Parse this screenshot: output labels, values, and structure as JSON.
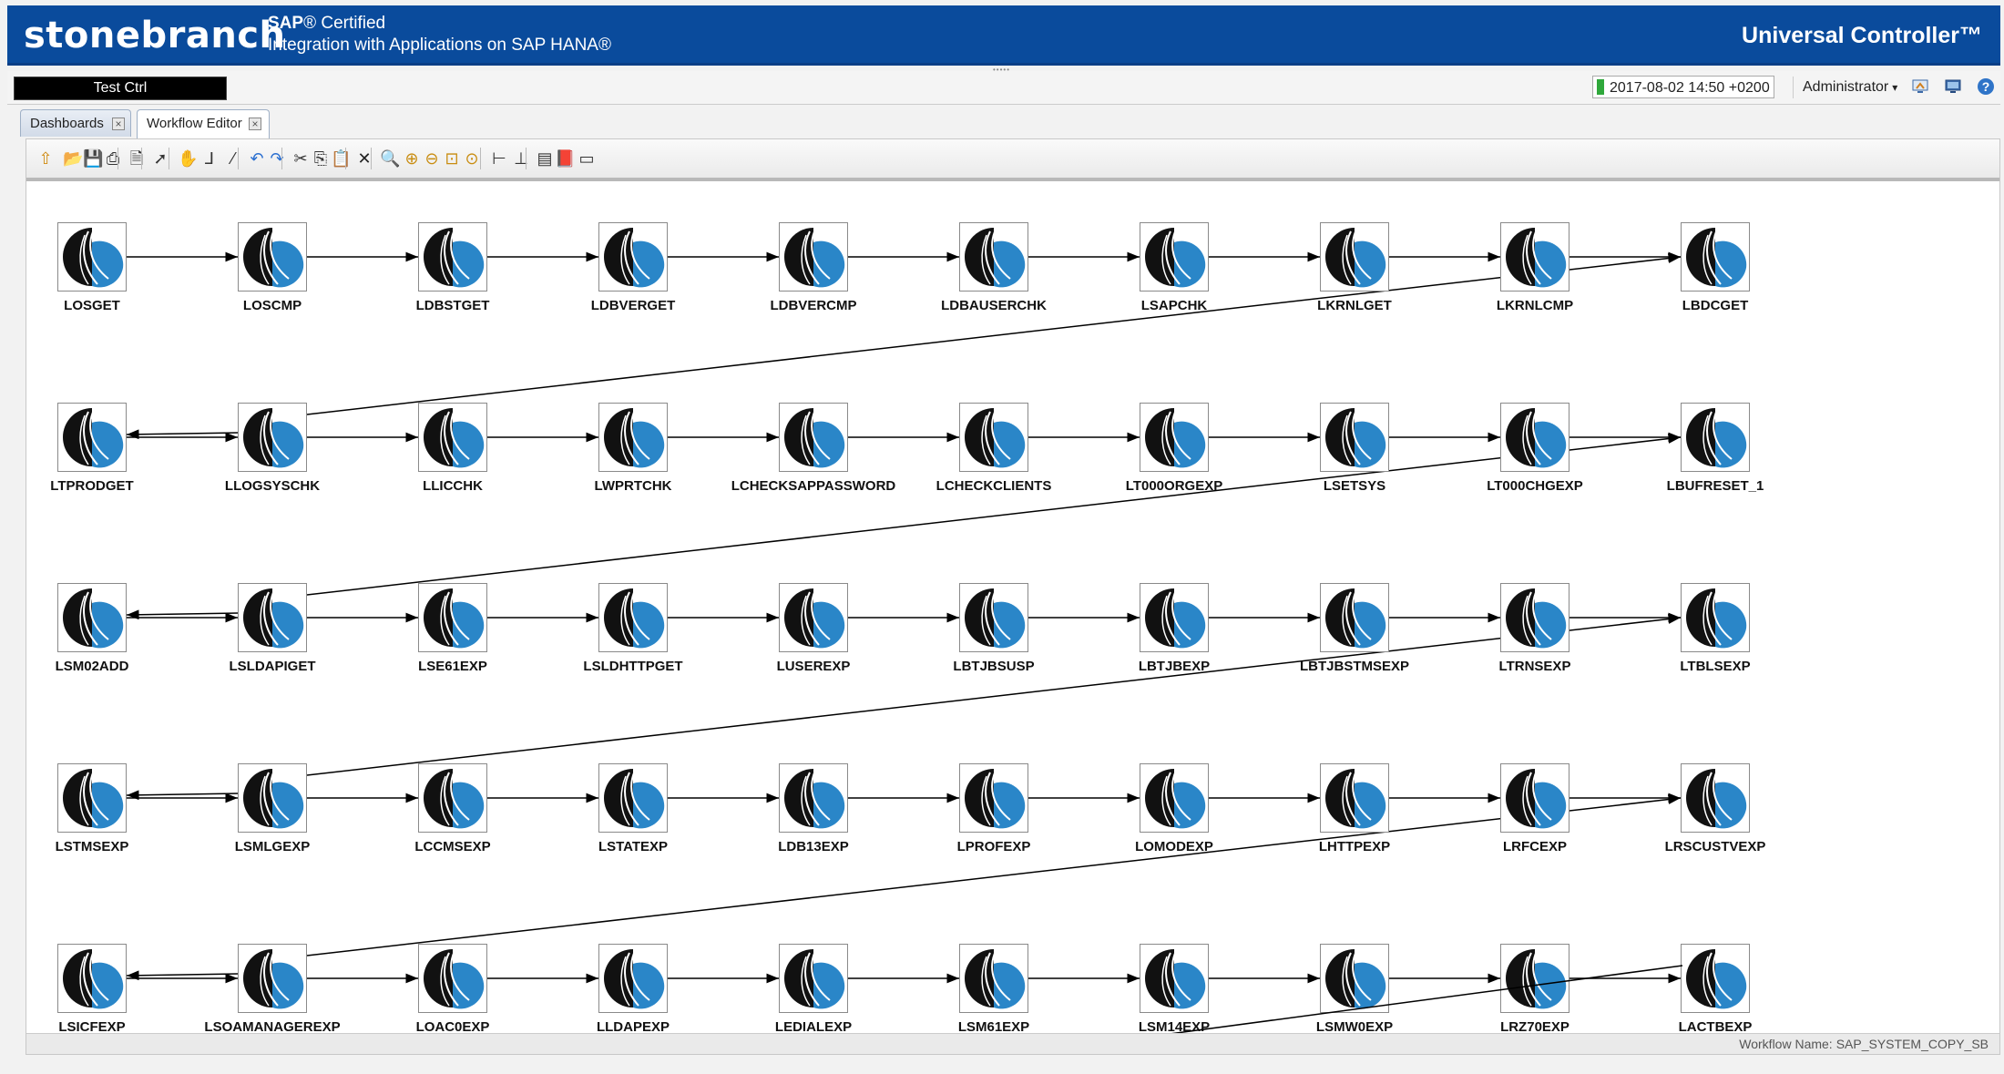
{
  "banner": {
    "brand": "stonebranch",
    "sap_line1": "SAP",
    "sap_line1_suffix": "® Certified",
    "sap_line2": "Integration with Applications on SAP HANA®",
    "product": "Universal Controller™",
    "color": "#0a4b9c"
  },
  "topbar": {
    "controller_name": "Test Ctrl",
    "timestamp": "2017-08-02 14:50 +0200",
    "status_color": "#2fa83b",
    "user": "Administrator",
    "icons": [
      "home-monitor-icon",
      "screen-icon",
      "help-icon"
    ]
  },
  "tabs": [
    {
      "label": "Dashboards",
      "active": false
    },
    {
      "label": "Workflow Editor",
      "active": true
    }
  ],
  "toolbar": {
    "buttons": [
      "up-arrow-icon",
      "open-folder-icon",
      "save-icon",
      "print-icon",
      "print-preview-icon",
      "select-pointer-icon",
      "pan-hand-icon",
      "connector-elbow-icon",
      "connector-straight-icon",
      "undo-icon",
      "redo-icon",
      "cut-icon",
      "copy-icon",
      "paste-icon",
      "delete-icon",
      "zoom-icon",
      "zoom-in-icon",
      "zoom-out-icon",
      "zoom-fit-icon",
      "zoom-actual-icon",
      "layout-horizontal-icon",
      "layout-tree-icon",
      "properties-icon",
      "book-icon",
      "monitor-icon"
    ]
  },
  "workflow": {
    "name_label": "Workflow Name:",
    "name": "SAP_SYSTEM_COPY_SB",
    "rows": [
      [
        "LOSGET",
        "LOSCMP",
        "LDBSTGET",
        "LDBVERGET",
        "LDBVERCMP",
        "LDBAUSERCHK",
        "LSAPCHK",
        "LKRNLGET",
        "LKRNLCMP",
        "LBDCGET"
      ],
      [
        "LTPRODGET",
        "LLOGSYSCHK",
        "LLICCHK",
        "LWPRTCHK",
        "LCHECKSAPPASSWORD",
        "LCHECKCLIENTS",
        "LT000ORGEXP",
        "LSETSYS",
        "LT000CHGEXP",
        "LBUFRESET_1"
      ],
      [
        "LSM02ADD",
        "LSLDAPIGET",
        "LSE61EXP",
        "LSLDHTTPGET",
        "LUSEREXP",
        "LBTJBSUSP",
        "LBTJBEXP",
        "LBTJBSTMSEXP",
        "LTRNSEXP",
        "LTBLSEXP"
      ],
      [
        "LSTMSEXP",
        "LSMLGEXP",
        "LCCMSEXP",
        "LSTATEXP",
        "LDB13EXP",
        "LPROFEXP",
        "LOMODEXP",
        "LHTTPEXP",
        "LRFCEXP",
        "LRSCUSTVEXP"
      ],
      [
        "LSICFEXP",
        "LSOAMANAGEREXP",
        "LOAC0EXP",
        "LLDAPEXP",
        "LEDIALEXP",
        "LSM61EXP",
        "LSM14EXP",
        "LSMW0EXP",
        "LRZ70EXP",
        "LACTBEXP"
      ]
    ]
  }
}
